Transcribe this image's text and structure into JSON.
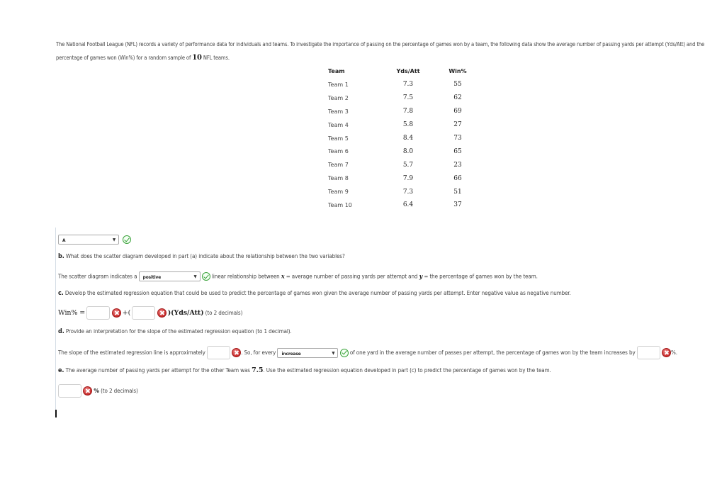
{
  "intro": {
    "text_before": "The National Football League (NFL) records a variety of performance data for individuals and teams. To investigate the importance of passing on the percentage of games won by a team, the following data show the average number of passing yards per attempt (Yds/Att) and the percentage of games won (Win%) for a random sample of ",
    "sample_size": "10",
    "text_after": " NFL teams."
  },
  "table": {
    "headers": [
      "Team",
      "Yds/Att",
      "Win%"
    ],
    "rows": [
      {
        "team": "Team 1",
        "yds": "7.3",
        "win": "55"
      },
      {
        "team": "Team 2",
        "yds": "7.5",
        "win": "62"
      },
      {
        "team": "Team 3",
        "yds": "7.8",
        "win": "69"
      },
      {
        "team": "Team 4",
        "yds": "5.8",
        "win": "27"
      },
      {
        "team": "Team 5",
        "yds": "8.4",
        "win": "73"
      },
      {
        "team": "Team 6",
        "yds": "8.0",
        "win": "65"
      },
      {
        "team": "Team 7",
        "yds": "5.7",
        "win": "23"
      },
      {
        "team": "Team 8",
        "yds": "7.9",
        "win": "66"
      },
      {
        "team": "Team 9",
        "yds": "7.3",
        "win": "51"
      },
      {
        "team": "Team 10",
        "yds": "6.4",
        "win": "37"
      }
    ]
  },
  "part_a": {
    "select_value": "A",
    "status": "correct"
  },
  "part_b": {
    "label": "b.",
    "question": "What does the scatter diagram developed in part (a) indicate about the relationship between the two variables?",
    "answer_prefix": "The scatter diagram indicates a",
    "select_value": "positive",
    "answer_mid": "linear relationship between",
    "x_var": "x",
    "x_def": "= average number of passing yards per attempt and",
    "y_var": "y",
    "y_def": "= the percentage of games won by the team.",
    "status": "correct"
  },
  "part_c": {
    "label": "c.",
    "question": "Develop the estimated regression equation that could be used to predict the percentage of games won given the average number of passing yards per attempt. Enter negative value as negative number.",
    "lhs": "Win% =",
    "intercept_value": "",
    "plus": "+(",
    "slope_value": "",
    "rhs": ")(Yds/Att)",
    "note": "(to 2 decimals)",
    "intercept_status": "incorrect",
    "slope_status": "incorrect"
  },
  "part_d": {
    "label": "d.",
    "question": "Provide an interpretation for the slope of the estimated regression equation (to 1 decimal).",
    "text1": "The slope of the estimated regression line is approximately",
    "slope_value": "",
    "text2": ". So, for every",
    "select_value": "increase",
    "text3": "of one yard in the average number of passes per attempt, the percentage of games won by the team increases by",
    "increase_value": "",
    "text4": "%.",
    "slope_status": "incorrect",
    "select_status": "correct",
    "increase_status": "incorrect"
  },
  "part_e": {
    "label": "e.",
    "text_before": "The average number of passing yards per attempt for the other Team was",
    "value": "7.5",
    "text_after": ". Use the estimated regression equation developed in part (c) to predict the percentage of games won by the team.",
    "answer_value": "",
    "unit": "%",
    "note": "(to 2 decimals)",
    "status": "incorrect"
  },
  "colors": {
    "correct": "#3aa23a",
    "incorrect": "#c62828"
  }
}
